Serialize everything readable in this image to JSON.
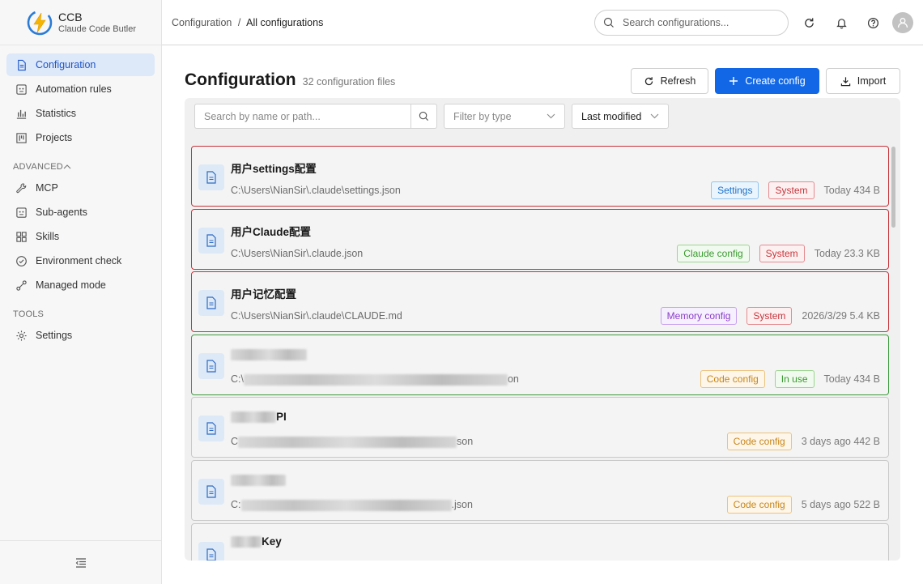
{
  "brand": {
    "name": "CCB",
    "subtitle": "Claude Code Butler"
  },
  "sidebar": {
    "items": [
      {
        "label": "Configuration",
        "icon": "file-icon",
        "active": true
      },
      {
        "label": "Automation rules",
        "icon": "robot-icon"
      },
      {
        "label": "Statistics",
        "icon": "bar-chart-icon"
      },
      {
        "label": "Projects",
        "icon": "kanban-icon"
      }
    ],
    "advanced_label": "ADVANCED",
    "advanced": [
      {
        "label": "MCP",
        "icon": "wrench-icon"
      },
      {
        "label": "Sub-agents",
        "icon": "robot-icon"
      },
      {
        "label": "Skills",
        "icon": "grid-icon"
      },
      {
        "label": "Environment check",
        "icon": "check-circle-icon"
      },
      {
        "label": "Managed mode",
        "icon": "link-icon"
      }
    ],
    "tools_label": "TOOLS",
    "tools": [
      {
        "label": "Settings",
        "icon": "gear-icon"
      }
    ]
  },
  "header": {
    "breadcrumb_root": "Configuration",
    "breadcrumb_sep": "/",
    "breadcrumb_current": "All configurations",
    "search_placeholder": "Search configurations..."
  },
  "main": {
    "title": "Configuration",
    "count": "32 configuration files",
    "refresh_label": "Refresh",
    "create_label": "Create config",
    "import_label": "Import",
    "filter_search_placeholder": "Search by name or path...",
    "filter_type_placeholder": "Filter by type",
    "sort_label": "Last modified"
  },
  "configs": [
    {
      "title": "用户settings配置",
      "path": "C:\\Users\\NianSir\\.claude\\settings.json",
      "tags": [
        "Settings",
        "System"
      ],
      "meta": "Today 434 B"
    },
    {
      "title": "用户Claude配置",
      "path": "C:\\Users\\NianSir\\.claude.json",
      "tags": [
        "Claude config",
        "System"
      ],
      "meta": "Today 23.3 KB"
    },
    {
      "title": "用户记忆配置",
      "path": "C:\\Users\\NianSir\\.claude\\CLAUDE.md",
      "tags": [
        "Memory config",
        "System"
      ],
      "meta": "2026/3/29 5.4 KB"
    },
    {
      "title_suffix": "",
      "path_prefix": "C:\\",
      "path_suffix": "on",
      "tags": [
        "Code config",
        "In use"
      ],
      "meta": "Today 434 B"
    },
    {
      "title_suffix": "PI",
      "path_prefix": "C",
      "path_suffix": "son",
      "tags": [
        "Code config"
      ],
      "meta": "3 days ago 442 B"
    },
    {
      "title_suffix": "",
      "path_prefix": "C:",
      "path_suffix": ".json",
      "tags": [
        "Code config"
      ],
      "meta": "5 days ago 522 B"
    },
    {
      "title_suffix": "Key"
    }
  ]
}
